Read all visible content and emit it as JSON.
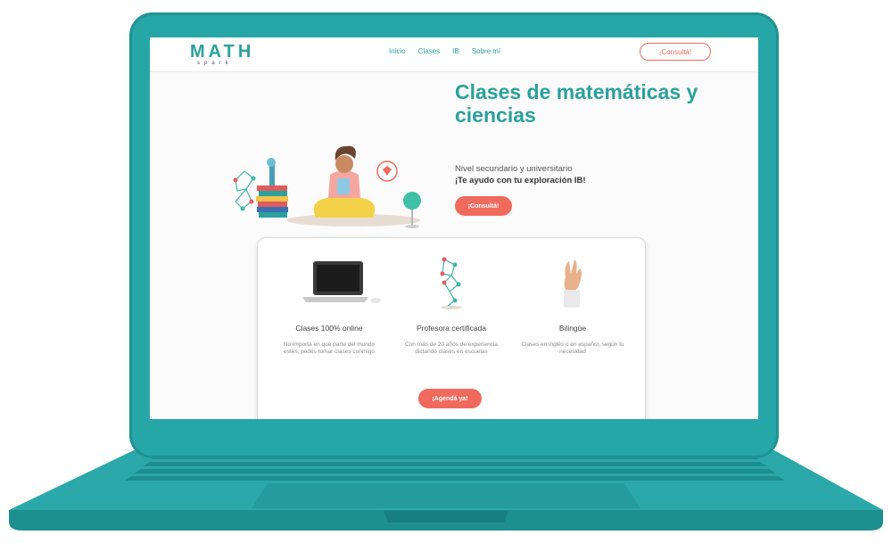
{
  "logo": {
    "word": "MATH",
    "sub": "spark"
  },
  "nav": {
    "links": [
      "Inicio",
      "Clases",
      "IB",
      "Sobre mí"
    ],
    "cta": "¡Consultá!"
  },
  "hero": {
    "title": "Clases de matemáticas y ciencias",
    "subtitle": "Nivel secundario y universitario",
    "highlight": "¡Te ayudo con tu exploración IB!",
    "button": "¡Consultá!"
  },
  "features": [
    {
      "icon": "laptop-icon",
      "title": "Clases 100% online",
      "desc": "No importa en qué parte del mundo estés, podés tomar clases conmigo"
    },
    {
      "icon": "molecule-icon",
      "title": "Profesora certificada",
      "desc": "Con más de 20 años de experiencia dictando clases en escuelas"
    },
    {
      "icon": "hand-gesture-icon",
      "title": "Bilingüe",
      "desc": "Clases en inglés o en español, según tu necesidad"
    }
  ],
  "card_button": "¡Agendá ya!",
  "colors": {
    "teal": "#2aa19c",
    "laptop": "#27a6a8",
    "coral": "#f06a5d"
  }
}
